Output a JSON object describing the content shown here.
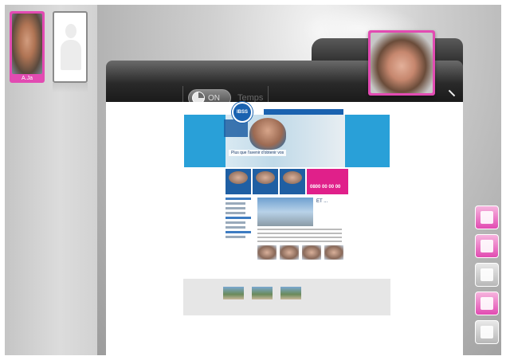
{
  "participants": [
    {
      "name": "A.Ja",
      "active": true
    },
    {
      "name": "",
      "active": false
    }
  ],
  "toolbar": {
    "toggle_label": "ON",
    "timer_label": "Temps"
  },
  "shared_document": {
    "logo_text": "IBSS",
    "nav_items": [
      "",
      "",
      "",
      ""
    ],
    "hero_caption": "Plus que l'avenir d'obtenir vos",
    "phone": "0800 00 00 00",
    "video_caption": "ET ..."
  },
  "tools": [
    {
      "name": "list-tool",
      "style": "pink"
    },
    {
      "name": "user-share-tool",
      "style": "pink"
    },
    {
      "name": "annotate-tool",
      "style": "grey"
    },
    {
      "name": "document-tool",
      "style": "pink"
    },
    {
      "name": "checklist-tool",
      "style": "grey"
    }
  ]
}
